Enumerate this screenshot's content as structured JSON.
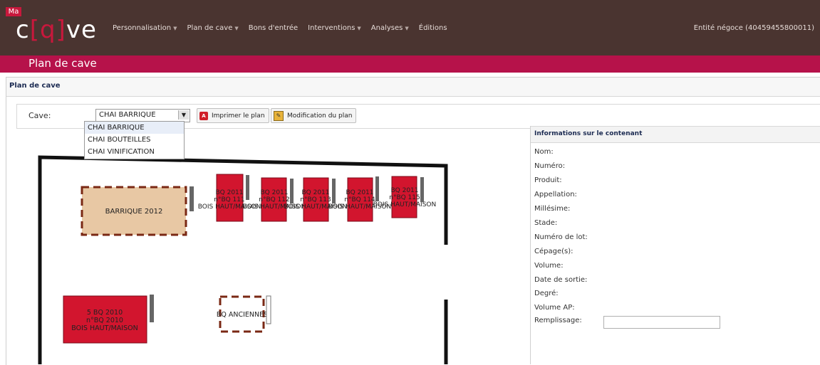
{
  "app": {
    "logo_badge": "Ma",
    "logo_text_pre": "c",
    "logo_text_q": "[q]",
    "logo_text_post": "ve",
    "nav": [
      {
        "label": "Personnalisation",
        "has_arrow": true
      },
      {
        "label": "Plan de cave",
        "has_arrow": true
      },
      {
        "label": "Bons d'entrée",
        "has_arrow": false
      },
      {
        "label": "Interventions",
        "has_arrow": true
      },
      {
        "label": "Analyses",
        "has_arrow": true
      },
      {
        "label": "Éditions",
        "has_arrow": false
      }
    ],
    "entity": "Entité négoce (40459455800011)"
  },
  "page": {
    "title": "Plan de cave",
    "panel_title": "Plan de cave"
  },
  "toolbar": {
    "cave_label": "Cave:",
    "selected_cave": "CHAI BARRIQUE",
    "print_label": "Imprimer le plan",
    "edit_label": "Modification du plan"
  },
  "dropdown": {
    "options": [
      "CHAI BARRIQUE",
      "CHAI BOUTEILLES",
      "CHAI VINIFICATION"
    ]
  },
  "plan": {
    "containers": [
      {
        "id": "barrique2012",
        "label": "BARRIQUE 2012"
      },
      {
        "id": "bq111",
        "line1": "BQ 2011",
        "line2": "n°BQ 111",
        "line3": "BOIS HAUT/MAISON"
      },
      {
        "id": "bq112",
        "line1": "BQ 2011",
        "line2": "n°BQ 112",
        "line3": "BOIS HAUT/MAISON"
      },
      {
        "id": "bq113",
        "line1": "BQ 2011",
        "line2": "n°BQ 113",
        "line3": "BOIS HAUT/MAISON"
      },
      {
        "id": "bq114",
        "line1": "BQ 2011",
        "line2": "n°BQ 114",
        "line3": "BOIS HAUT/MAISON"
      },
      {
        "id": "bq115",
        "line1": "BQ 2011",
        "line2": "n°BQ 115",
        "line3": "BOIS HAUT/MAISON"
      },
      {
        "id": "bq2010",
        "line1": "5 BQ 2010",
        "line2": "n°BQ 2010",
        "line3": "BOIS HAUT/MAISON"
      },
      {
        "id": "bqanciennes",
        "label": "BQ ANCIENNES"
      }
    ],
    "colors": {
      "filled": "#d2152e",
      "empty_barrique": "#e8c8a4",
      "dash": "#7a2814"
    }
  },
  "info": {
    "title": "Informations sur le contenant",
    "fields": [
      "Nom:",
      "Numéro:",
      "Produit:",
      "Appellation:",
      "Millésime:",
      "Stade:",
      "Numéro de lot:",
      "Cépage(s):",
      "Volume:",
      "Date de sortie:",
      "Degré:",
      "Volume AP:",
      "Remplissage:"
    ]
  }
}
